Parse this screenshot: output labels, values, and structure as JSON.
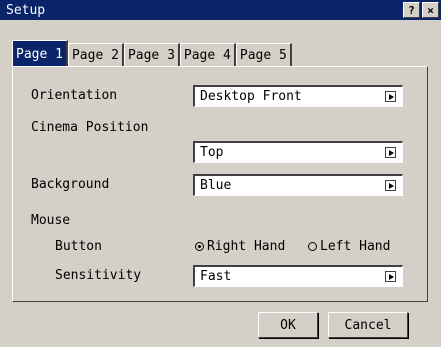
{
  "window": {
    "title": "Setup",
    "help_label": "?",
    "close_label": "×"
  },
  "tabs": [
    {
      "label": "Page 1",
      "active": true
    },
    {
      "label": "Page 2",
      "active": false
    },
    {
      "label": "Page 3",
      "active": false
    },
    {
      "label": "Page 4",
      "active": false
    },
    {
      "label": "Page 5",
      "active": false
    }
  ],
  "orientation": {
    "label": "Orientation",
    "value": "Desktop Front"
  },
  "cinema_position": {
    "label": "Cinema Position",
    "value": "Top"
  },
  "background": {
    "label": "Background",
    "value": "Blue"
  },
  "mouse": {
    "label": "Mouse",
    "button": {
      "label": "Button",
      "options": [
        "Right Hand",
        "Left Hand"
      ],
      "selected": "Right Hand"
    },
    "sensitivity": {
      "label": "Sensitivity",
      "value": "Fast"
    }
  },
  "footer": {
    "ok_label": "OK",
    "cancel_label": "Cancel"
  }
}
